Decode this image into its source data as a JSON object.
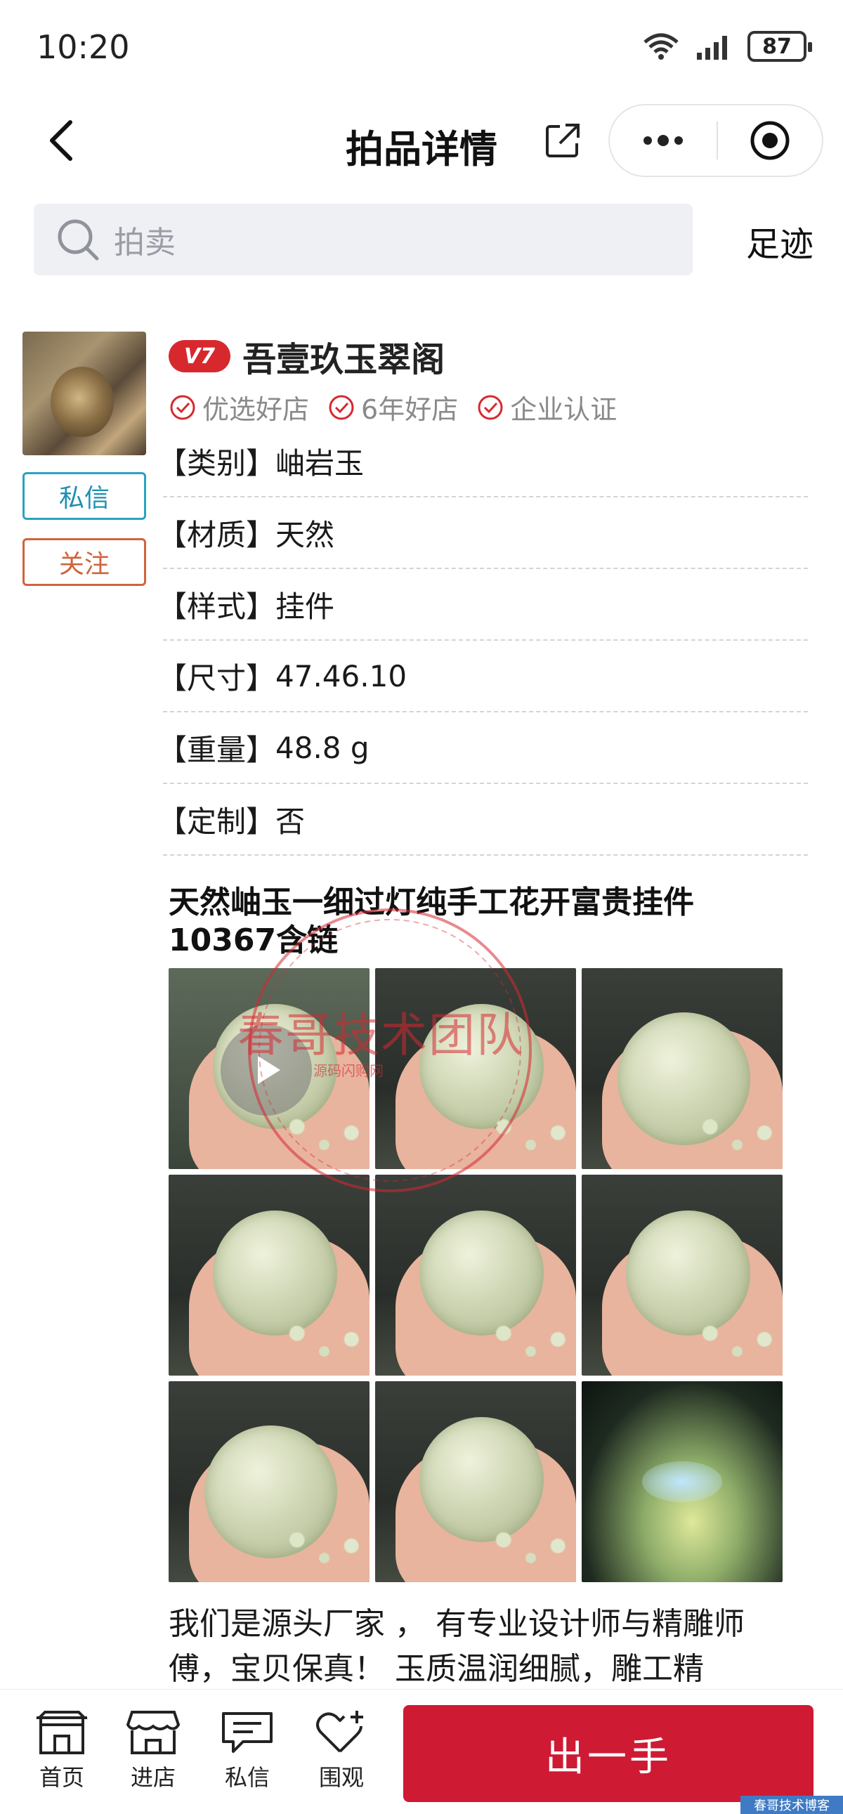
{
  "status_bar": {
    "time": "10:20",
    "battery": "87"
  },
  "nav": {
    "title": "拍品详情"
  },
  "search": {
    "placeholder": "拍卖",
    "footprint": "足迹"
  },
  "shop": {
    "level": "V7",
    "name": "吾壹玖玉翠阁",
    "tags": [
      "优选好店",
      "6年好店",
      "企业认证"
    ],
    "message_label": "私信",
    "follow_label": "关注"
  },
  "attributes": [
    {
      "key": "【类别】",
      "value": "岫岩玉"
    },
    {
      "key": "【材质】",
      "value": "天然"
    },
    {
      "key": "【样式】",
      "value": "挂件"
    },
    {
      "key": "【尺寸】",
      "value": "47.46.10"
    },
    {
      "key": "【重量】",
      "value": "48.8 g"
    },
    {
      "key": "【定制】",
      "value": "否"
    }
  ],
  "product": {
    "title": "天然岫玉一细过灯纯手工花开富贵挂件10367含链",
    "description": "我们是源头厂家 ， 有专业设计师与精雕师傅，宝贝保真！ 玉质温润细腻，雕工精"
  },
  "watermark": {
    "main": "春哥技术团队",
    "sub": "源码闪购网",
    "corner": "春哥技术博客"
  },
  "bottom_bar": {
    "tabs": [
      {
        "label": "首页",
        "icon": "home-icon"
      },
      {
        "label": "进店",
        "icon": "shop-icon"
      },
      {
        "label": "私信",
        "icon": "message-icon"
      },
      {
        "label": "围观",
        "icon": "heart-add-icon"
      }
    ],
    "cta_label": "出一手"
  },
  "colors": {
    "accent": "#cf1a33",
    "badge": "#d7282e",
    "message": "#2aa2c0",
    "follow": "#d0643c"
  }
}
